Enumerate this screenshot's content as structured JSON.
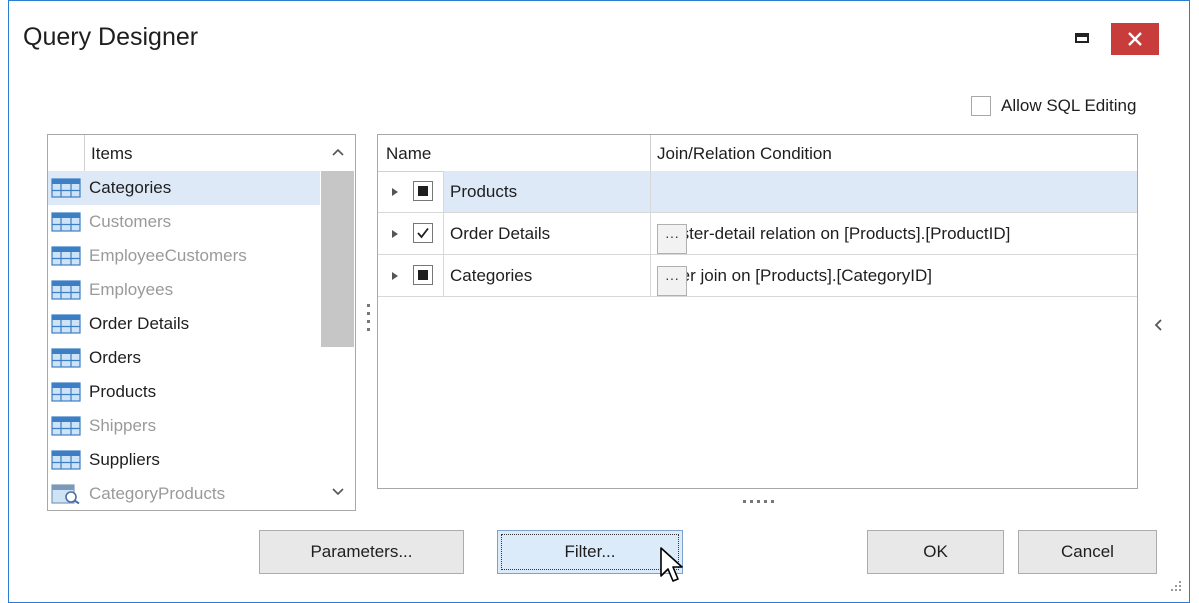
{
  "window": {
    "title": "Query Designer",
    "accent_color": "#2b7cd3",
    "close_color": "#c83c3c"
  },
  "titlebar_buttons": {
    "maximize_icon": "maximize-icon",
    "close_icon": "close-icon"
  },
  "options": {
    "allow_sql_editing": {
      "label": "Allow SQL Editing",
      "checked": false
    }
  },
  "items_panel": {
    "header": "Items",
    "items": [
      {
        "label": "Categories",
        "icon": "table-icon",
        "dim": false,
        "selected": true
      },
      {
        "label": "Customers",
        "icon": "table-icon",
        "dim": true,
        "selected": false
      },
      {
        "label": "EmployeeCustomers",
        "icon": "table-icon",
        "dim": true,
        "selected": false
      },
      {
        "label": "Employees",
        "icon": "table-icon",
        "dim": true,
        "selected": false
      },
      {
        "label": "Order Details",
        "icon": "table-icon",
        "dim": false,
        "selected": false
      },
      {
        "label": "Orders",
        "icon": "table-icon",
        "dim": false,
        "selected": false
      },
      {
        "label": "Products",
        "icon": "table-icon",
        "dim": false,
        "selected": false
      },
      {
        "label": "Shippers",
        "icon": "table-icon",
        "dim": true,
        "selected": false
      },
      {
        "label": "Suppliers",
        "icon": "table-icon",
        "dim": false,
        "selected": false
      },
      {
        "label": "CategoryProducts",
        "icon": "view-icon",
        "dim": true,
        "selected": false
      }
    ]
  },
  "relations_grid": {
    "columns": [
      "Name",
      "Join/Relation Condition"
    ],
    "rows": [
      {
        "name": "Products",
        "condition": "",
        "check": "indeterminate",
        "selected": true,
        "has_ellipsis": false
      },
      {
        "name": "Order Details",
        "condition": "Master-detail relation on [Products].[ProductID]",
        "check": "checked",
        "selected": false,
        "has_ellipsis": true
      },
      {
        "name": "Categories",
        "condition": "Inner join on [Products].[CategoryID]",
        "check": "indeterminate",
        "selected": false,
        "has_ellipsis": true
      }
    ],
    "ellipsis_label": "···"
  },
  "buttons": {
    "parameters": "Parameters...",
    "filter": "Filter...",
    "ok": "OK",
    "cancel": "Cancel"
  }
}
